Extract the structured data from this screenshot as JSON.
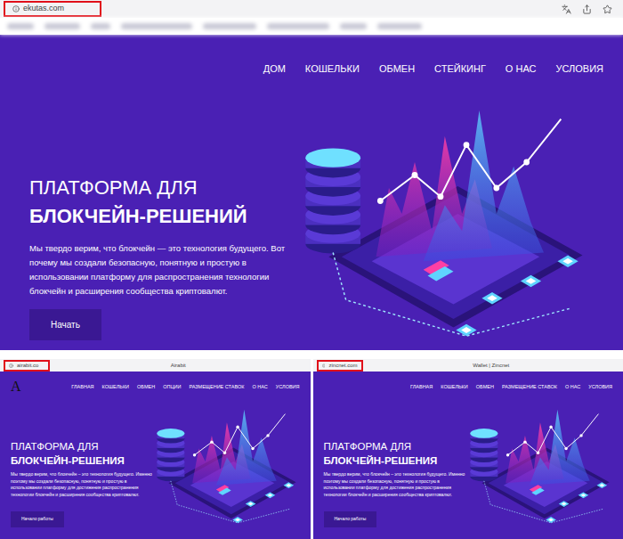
{
  "main_window": {
    "address": "ekutas.com",
    "highlighted": true,
    "nav": [
      "ДОМ",
      "КОШЕЛЬКИ",
      "ОБМЕН",
      "СТЕЙКИНГ",
      "О НАС",
      "УСЛОВИЯ"
    ],
    "heading_light": "ПЛАТФОРМА ДЛЯ",
    "heading_bold": "БЛОКЧЕЙН-РЕШЕНИЙ",
    "text": "Мы твердо верим, что блокчейн — это технология будущего. Вот почему мы создали безопасную, понятную и простую в использовании платформу для распространения технологии блокчейн и расширения сообщества криптовалют.",
    "button": "Начать"
  },
  "clones": [
    {
      "title": "Airabit",
      "address": "airabit.co",
      "highlighted": true,
      "logo": "A",
      "nav": [
        "ГЛАВНАЯ",
        "КОШЕЛЬКИ",
        "ОБМЕН",
        "ОПЦИИ",
        "РАЗМЕЩЕНИЕ СТАВОК",
        "О НАС",
        "УСЛОВИЯ"
      ],
      "heading_light": "ПЛАТФОРМА ДЛЯ",
      "heading_bold": "БЛОКЧЕЙН-РЕШЕНИЯ",
      "text": "Мы твердо верим, что блокчейн – это технология будущего. Именно поэтому мы создали безопасную, понятную и простую в использовании платформу для достижения распространения технологии блокчейн и расширения сообщества криптовалют.",
      "button": "Начало работы"
    },
    {
      "title": "Wallet | Zincnet",
      "address": "zincnet.com",
      "highlighted": true,
      "nav": [
        "ГЛАВНАЯ",
        "КОШЕЛЬКИ",
        "ОБМЕН",
        "РАЗМЕЩЕНИЕ СТАВОК",
        "О НАС",
        "УСЛОВИЯ"
      ],
      "heading_light": "ПЛАТФОРМА ДЛЯ",
      "heading_bold": "БЛОКЧЕЙН-РЕШЕНИЯ",
      "text": "Мы твердо верим, что блокчейн – это технология будущего. Именно поэтому мы создали безопасную, понятную и простую в использовании платформу для достижения распространения технологии блокчейн и расширения сообщества криптовалют.",
      "button": "Начало работы"
    }
  ]
}
